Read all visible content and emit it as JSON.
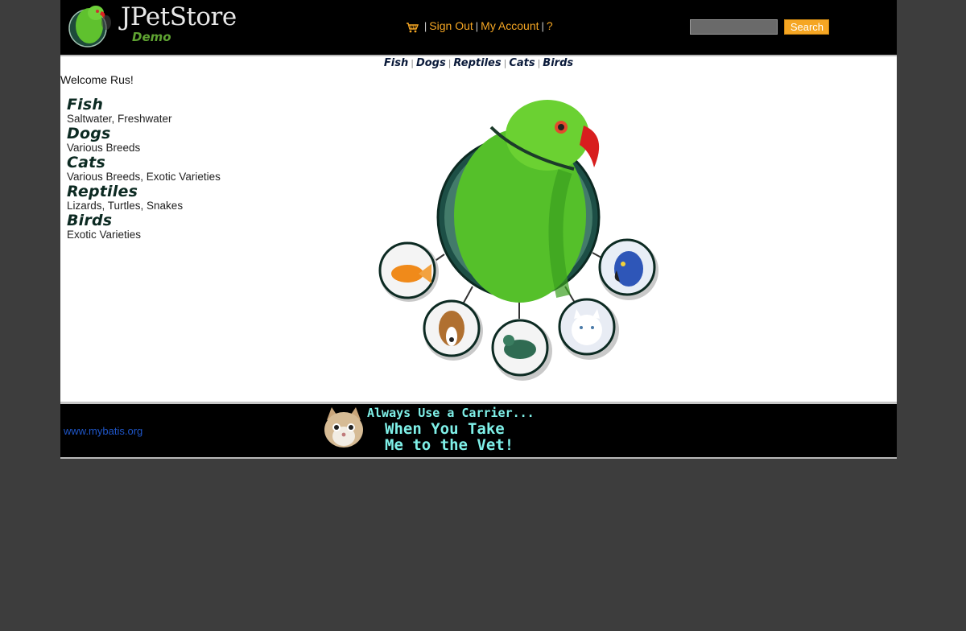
{
  "header": {
    "logo_title": "JPetStore",
    "logo_subtitle": "Demo",
    "menu": {
      "cart_icon": "shopping-cart-icon",
      "sign_out": "Sign Out",
      "my_account": "My Account",
      "help": "?"
    },
    "search": {
      "value": "",
      "placeholder": "",
      "button_label": "Search"
    }
  },
  "quicklinks": [
    "Fish",
    "Dogs",
    "Reptiles",
    "Cats",
    "Birds"
  ],
  "welcome": "Welcome Rus!",
  "sidebar": {
    "categories": [
      {
        "name": "Fish",
        "description": "Saltwater, Freshwater"
      },
      {
        "name": "Dogs",
        "description": "Various Breeds"
      },
      {
        "name": "Cats",
        "description": "Various Breeds, Exotic Varieties"
      },
      {
        "name": "Reptiles",
        "description": "Lizards, Turtles, Snakes"
      },
      {
        "name": "Birds",
        "description": "Exotic Varieties"
      }
    ]
  },
  "footer": {
    "link": "www.mybatis.org",
    "banner_line1": "Always Use a Carrier...",
    "banner_line2": "When You Take",
    "banner_line3": "Me to the Vet!"
  },
  "colors": {
    "header_bg": "#000000",
    "page_bg": "#3d3d3d",
    "link_orange": "#f5a623",
    "footer_link": "#1f56c8",
    "banner_text": "#7ff0e8"
  }
}
